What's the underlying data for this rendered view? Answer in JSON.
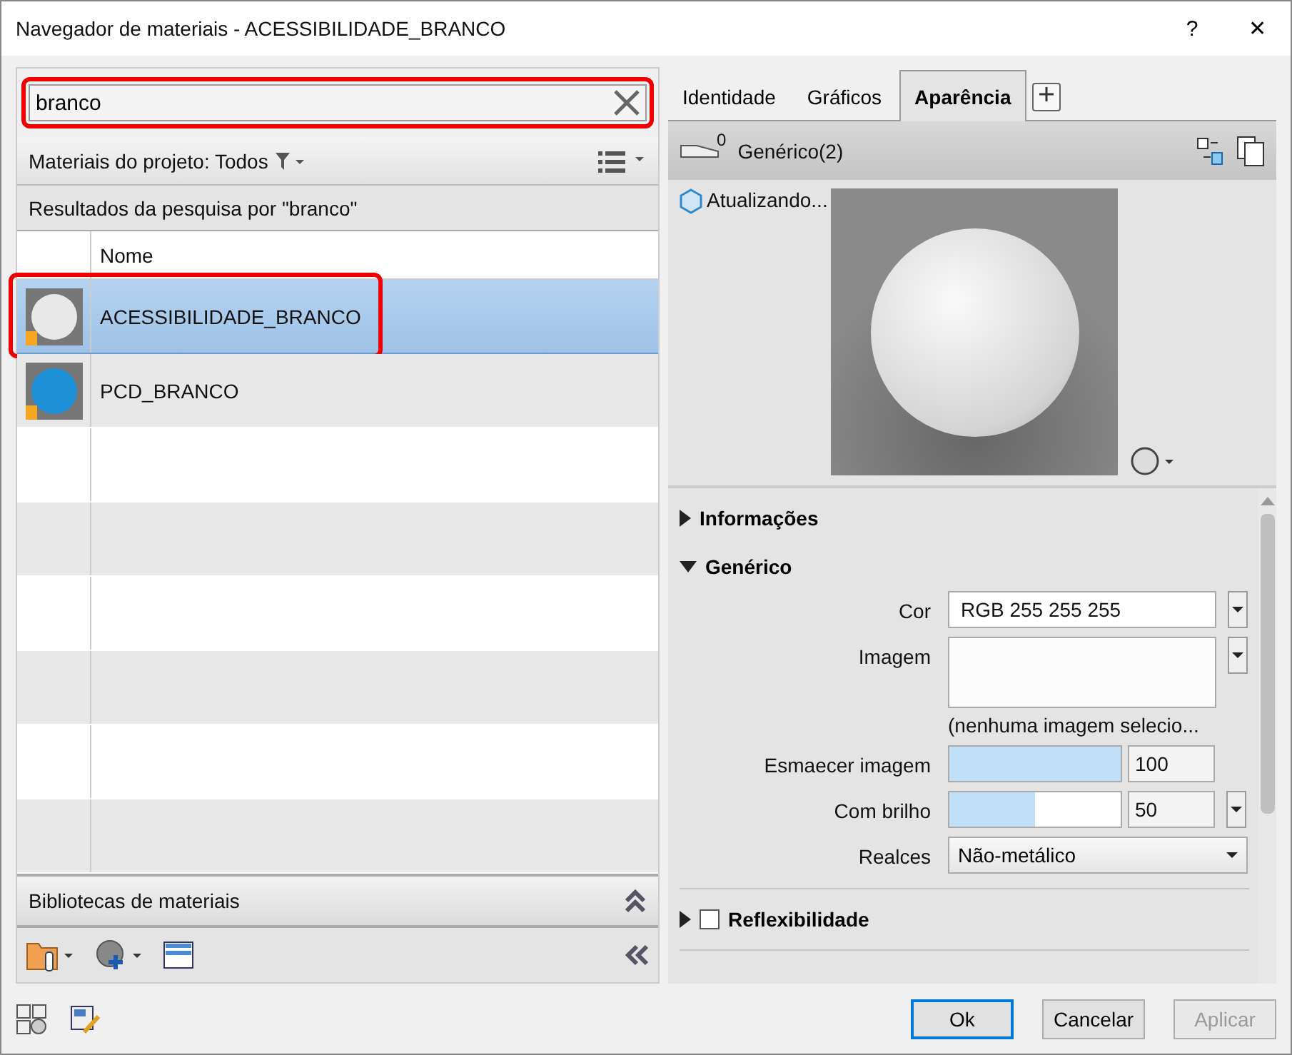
{
  "window": {
    "title": "Navegador de materiais - ACESSIBILIDADE_BRANCO",
    "help": "?",
    "close": "✕"
  },
  "search": {
    "value": "branco",
    "highlighted": true
  },
  "filter_bar": {
    "label": "Materiais do projeto: Todos"
  },
  "results_header": "Resultados da pesquisa por \"branco\"",
  "table": {
    "columns": [
      "Nome"
    ],
    "rows": [
      {
        "name": "ACESSIBILIDADE_BRANCO",
        "selected": true,
        "highlighted": true,
        "color": "#e8e8e8"
      },
      {
        "name": "PCD_BRANCO",
        "selected": false,
        "highlighted": false,
        "color": "#1e90d8"
      }
    ]
  },
  "libraries": {
    "title": "Bibliotecas de materiais"
  },
  "tabs": [
    {
      "label": "Identidade",
      "selected": false
    },
    {
      "label": "Gráficos",
      "selected": false
    },
    {
      "label": "Aparência",
      "selected": true
    }
  ],
  "asset": {
    "count": "0",
    "name": "Genérico(2)",
    "status": "Atualizando..."
  },
  "sections": [
    {
      "title": "Informações",
      "expanded": false
    },
    {
      "title": "Genérico",
      "expanded": true
    }
  ],
  "properties": [
    {
      "kind": "color",
      "label": "Cor",
      "value": "RGB 255 255 255"
    },
    {
      "kind": "image",
      "label": "Imagem",
      "note": "(nenhuma imagem selecio..."
    },
    {
      "kind": "slider",
      "label": "Esmaecer imagem",
      "level": 1,
      "value": "100",
      "dropdown": false
    },
    {
      "kind": "slider",
      "label": "Com brilho",
      "level": 0.5,
      "value": "50",
      "dropdown": true
    },
    {
      "kind": "select",
      "label": "Realces",
      "value": "Não-metálico"
    }
  ],
  "subsections": [
    {
      "title": "Reflexibilidade",
      "checked": false,
      "expanded": false
    }
  ],
  "buttons": [
    {
      "label": "Ok",
      "disabled": false,
      "default": true
    },
    {
      "label": "Cancelar",
      "disabled": false,
      "default": false
    },
    {
      "label": "Aplicar",
      "disabled": true,
      "default": false
    }
  ]
}
